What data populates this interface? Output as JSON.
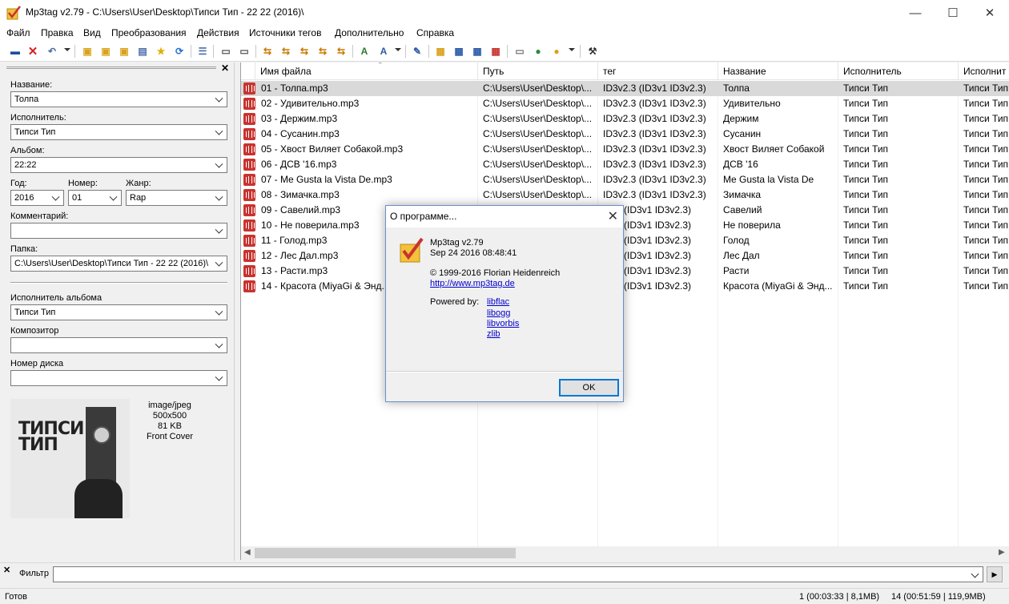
{
  "window": {
    "title": "Mp3tag v2.79  -  C:\\Users\\User\\Desktop\\Типси Тип - 22 22 (2016)\\",
    "minimize": "—",
    "maximize": "☐",
    "close": "✕"
  },
  "menu": [
    "Файл",
    "Правка",
    "Вид",
    "Преобразования",
    "Действия",
    "Источники тегов",
    "Дополнительно",
    "Справка"
  ],
  "toolbar_icons": [
    "save-icon",
    "remove-tag-icon",
    "undo-icon",
    "add-directory-icon",
    "add-icon",
    "open-folder-icon",
    "favorites-icon",
    "refresh-icon",
    "tag-to-filename-icon",
    "convert-icon",
    "actions-icon",
    "autonumber-icon",
    "case-conversion-icon",
    "extended-tags-icon",
    "export-icon",
    "playlist-icon",
    "options-icon"
  ],
  "left_panel": {
    "labels": {
      "title": "Название:",
      "artist": "Исполнитель:",
      "album": "Альбом:",
      "year": "Год:",
      "track": "Номер:",
      "genre": "Жанр:",
      "comment": "Комментарий:",
      "folder": "Папка:",
      "album_artist": "Исполнитель альбома",
      "composer": "Композитор",
      "disc": "Номер диска"
    },
    "values": {
      "title": "Толпа",
      "artist": "Типси Тип",
      "album": "22:22",
      "year": "2016",
      "track": "01",
      "genre": "Rap",
      "comment": "",
      "folder": "C:\\Users\\User\\Desktop\\Типси Тип - 22 22 (2016)\\",
      "album_artist": "Типси Тип",
      "composer": "",
      "disc": ""
    },
    "cover": {
      "art_text": "ТИПСИ ТИП",
      "mime": "image/jpeg",
      "dimensions": "500x500",
      "size": "81 KB",
      "type": "Front Cover"
    }
  },
  "file_list": {
    "columns": [
      "Имя файла",
      "Путь",
      "тег",
      "Название",
      "Исполнитель",
      "Исполнит"
    ],
    "rows": [
      {
        "file": "01 - Толпа.mp3",
        "path": "C:\\Users\\User\\Desktop\\...",
        "tag": "ID3v2.3 (ID3v1 ID3v2.3)",
        "title": "Толпа",
        "artist": "Типси Тип",
        "album_artist": "Типси Тип"
      },
      {
        "file": "02 - Удивительно.mp3",
        "path": "C:\\Users\\User\\Desktop\\...",
        "tag": "ID3v2.3 (ID3v1 ID3v2.3)",
        "title": "Удивительно",
        "artist": "Типси Тип",
        "album_artist": "Типси Тип"
      },
      {
        "file": "03 - Держим.mp3",
        "path": "C:\\Users\\User\\Desktop\\...",
        "tag": "ID3v2.3 (ID3v1 ID3v2.3)",
        "title": "Держим",
        "artist": "Типси Тип",
        "album_artist": "Типси Тип"
      },
      {
        "file": "04 - Сусанин.mp3",
        "path": "C:\\Users\\User\\Desktop\\...",
        "tag": "ID3v2.3 (ID3v1 ID3v2.3)",
        "title": "Сусанин",
        "artist": "Типси Тип",
        "album_artist": "Типси Тип"
      },
      {
        "file": "05 - Хвост Виляет Собакой.mp3",
        "path": "C:\\Users\\User\\Desktop\\...",
        "tag": "ID3v2.3 (ID3v1 ID3v2.3)",
        "title": "Хвост Виляет Собакой",
        "artist": "Типси Тип",
        "album_artist": "Типси Тип"
      },
      {
        "file": "06 - ДСВ '16.mp3",
        "path": "C:\\Users\\User\\Desktop\\...",
        "tag": "ID3v2.3 (ID3v1 ID3v2.3)",
        "title": "ДСВ '16",
        "artist": "Типси Тип",
        "album_artist": "Типси Тип"
      },
      {
        "file": "07 - Me Gusta la Vista De.mp3",
        "path": "C:\\Users\\User\\Desktop\\...",
        "tag": "ID3v2.3 (ID3v1 ID3v2.3)",
        "title": "Me Gusta la Vista De",
        "artist": "Типси Тип",
        "album_artist": "Типси Тип"
      },
      {
        "file": "08 - Зимачка.mp3",
        "path": "C:\\Users\\User\\Desktop\\...",
        "tag": "ID3v2.3 (ID3v1 ID3v2.3)",
        "title": "Зимачка",
        "artist": "Типси Тип",
        "album_artist": "Типси Тип"
      },
      {
        "file": "09 - Савелий.mp3",
        "path": "",
        "tag": "v2.3 (ID3v1 ID3v2.3)",
        "title": "Савелий",
        "artist": "Типси Тип",
        "album_artist": "Типси Тип"
      },
      {
        "file": "10 - Не поверила.mp3",
        "path": "",
        "tag": "v2.3 (ID3v1 ID3v2.3)",
        "title": "Не поверила",
        "artist": "Типси Тип",
        "album_artist": "Типси Тип"
      },
      {
        "file": "11 - Голод.mp3",
        "path": "",
        "tag": "v2.3 (ID3v1 ID3v2.3)",
        "title": "Голод",
        "artist": "Типси Тип",
        "album_artist": "Типси Тип"
      },
      {
        "file": "12 - Лес Дал.mp3",
        "path": "",
        "tag": "v2.3 (ID3v1 ID3v2.3)",
        "title": "Лес Дал",
        "artist": "Типси Тип",
        "album_artist": "Типси Тип"
      },
      {
        "file": "13 - Расти.mp3",
        "path": "",
        "tag": "v2.3 (ID3v1 ID3v2.3)",
        "title": "Расти",
        "artist": "Типси Тип",
        "album_artist": "Типси Тип"
      },
      {
        "file": "14 - Красота (MiyaGi & Энд...",
        "path": "",
        "tag": "v2.3 (ID3v1 ID3v2.3)",
        "title": "Красота (MiyaGi & Энд...",
        "artist": "Типси Тип",
        "album_artist": "Типси Тип"
      }
    ],
    "selected_index": 0
  },
  "filter": {
    "label": "Фильтр",
    "value": ""
  },
  "status": {
    "left": "Готов",
    "selected": "1 (00:03:33 | 8,1MB)",
    "total": "14 (00:51:59 | 119,9MB)"
  },
  "about_dialog": {
    "title": "О программе...",
    "app_version": "Mp3tag v2.79",
    "build_date": "Sep 24 2016 08:48:41",
    "copyright": "© 1999-2016 Florian Heidenreich",
    "website": "http://www.mp3tag.de",
    "powered_by_label": "Powered by:",
    "libraries": [
      "libflac",
      "libogg",
      "libvorbis",
      "zlib"
    ],
    "ok_label": "OK"
  },
  "colors": {
    "selected_row": "#d9d9d9",
    "file_icon": "#c8332e",
    "link": "#0000cc",
    "dialog_border": "#6b8fc9"
  }
}
